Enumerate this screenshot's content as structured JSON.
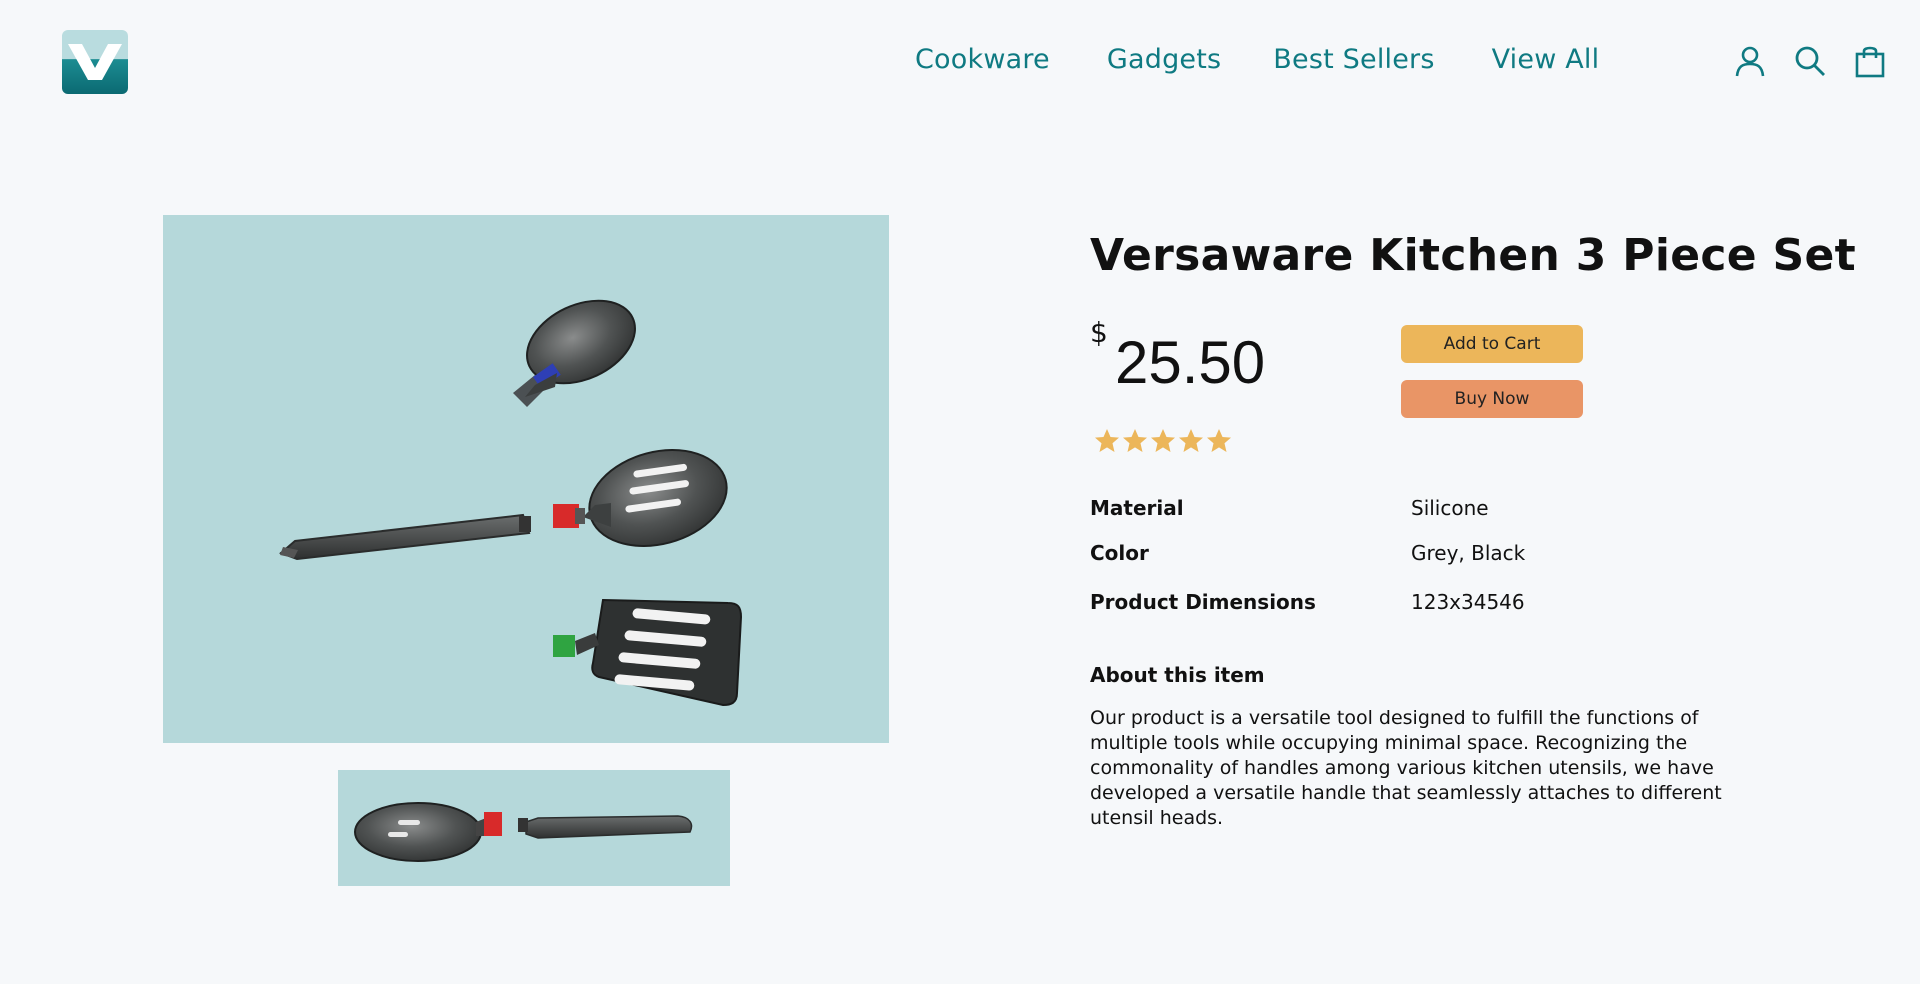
{
  "brand": {
    "logo_icon": "v-logo-icon",
    "accent_color": "#0f7a82"
  },
  "nav": {
    "items": [
      {
        "label": "Cookware"
      },
      {
        "label": "Gadgets"
      },
      {
        "label": "Best Sellers"
      },
      {
        "label": "View All"
      }
    ]
  },
  "header_icons": [
    "user-icon",
    "search-icon",
    "shopping-bag-icon"
  ],
  "product": {
    "title": "Versaware Kitchen 3 Piece Set",
    "currency_symbol": "$",
    "price": "25.50",
    "rating": 5,
    "rating_max": 5,
    "star_color": "#ecb65a",
    "add_to_cart_label": "Add to Cart",
    "buy_now_label": "Buy Now",
    "specs": [
      {
        "label": "Material",
        "value": "Silicone"
      },
      {
        "label": "Color",
        "value": "Grey, Black"
      },
      {
        "label": "Product Dimensions",
        "value": "123x34546"
      }
    ],
    "about_heading": "About this item",
    "about_text": "Our product is a versatile tool designed to fulfill the functions of multiple tools while occupying minimal space. Recognizing the commonality of handles among various kitchen utensils, we have developed a versatile handle that seamlessly attaches to different utensil heads."
  },
  "colors": {
    "add_to_cart": "#ecb65a",
    "buy_now": "#e99566",
    "image_background": "#b5d8da"
  }
}
